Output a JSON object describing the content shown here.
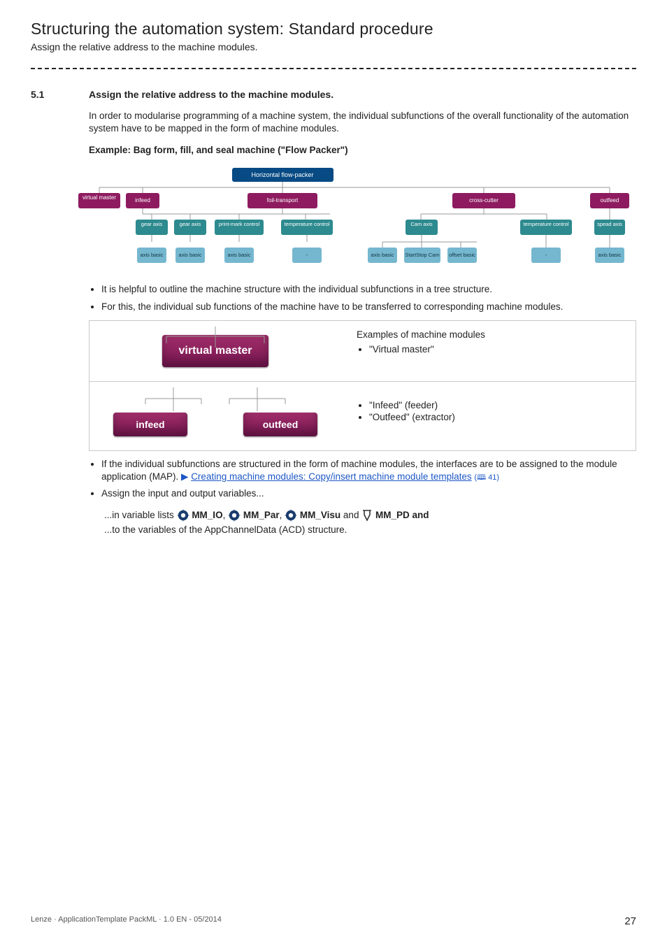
{
  "chapter_title": "Structuring the automation system: Standard procedure",
  "sub_title": "Assign the relative address to the machine modules.",
  "section": {
    "num": "5.1",
    "heading": "Assign the relative address to the machine modules."
  },
  "intro_para": "In order to modularise programming of a machine system, the individual subfunctions of the overall functionality of the automation system have to be mapped in the form of machine modules.",
  "example_heading": "Example: Bag form, fill, and seal machine (\"Flow Packer\")",
  "tree": {
    "top": "Horizontal flow-packer",
    "row1": [
      "virtual master",
      "infeed",
      "foil-transport",
      "cross-cutter",
      "outfeed"
    ],
    "row2_left": [
      "gear axis",
      "gear axis",
      "print-mark control",
      "temperature control"
    ],
    "row2_mid": [
      "Cam axis",
      "temperature control"
    ],
    "row2_right": [
      "spead axis"
    ],
    "row3_left": [
      "axis basic",
      "axis basic",
      "axis basic",
      "-"
    ],
    "row3_mid": [
      "axis basic",
      "StartStop Cam",
      "offset basic",
      "-"
    ],
    "row3_right": [
      "axis basic"
    ]
  },
  "bullets_a": [
    "It is helpful to outline the machine structure with the individual subfunctions in a tree structure.",
    "For this, the individual sub functions of the machine have to be transferred to corresponding machine modules."
  ],
  "modules": {
    "heading": "Examples of machine modules",
    "row1": {
      "pill": "virtual master",
      "items": [
        "\"Virtual master\""
      ]
    },
    "row2": {
      "pill1": "infeed",
      "pill2": "outfeed",
      "items": [
        "\"Infeed\" (feeder)",
        "\"Outfeed\" (extractor)"
      ]
    }
  },
  "bullets_b": {
    "b1_pre": "If the individual subfunctions are structured in the form of machine modules, the interfaces are to be assigned to the module application (MAP). ",
    "b1_link": "Creating machine modules: Copy/insert machine module templates",
    "b1_page": "41",
    "b2": "Assign the input and output variables..."
  },
  "var_para": {
    "pre": "...in variable lists ",
    "v1": "MM_IO",
    "v2": "MM_Par",
    "v3": "MM_Visu",
    "and": " and ",
    "v4": "MM_PD and",
    "line2": "...to the variables of the AppChannelData (ACD) structure."
  },
  "footer": {
    "left": "Lenze · ApplicationTemplate PackML · 1.0 EN - 05/2014",
    "page": "27"
  }
}
